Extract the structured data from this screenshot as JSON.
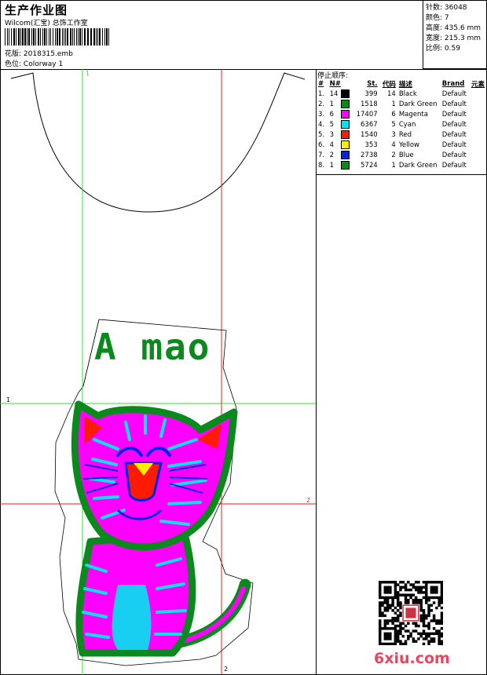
{
  "header": {
    "title": "生产作业图",
    "company": "Wilcom(汇宝) 总饰工作室",
    "design_label": "花版:",
    "design_value": "2018315.emb",
    "colorway_label": "色位:",
    "colorway_value": "Colorway 1"
  },
  "stats": [
    {
      "label": "针数:",
      "value": "36048"
    },
    {
      "label": "颜色:",
      "value": "7"
    },
    {
      "label": "高度:",
      "value": "435.6 mm"
    },
    {
      "label": "宽度:",
      "value": "215.3 mm"
    },
    {
      "label": "比例:",
      "value": "0.59"
    }
  ],
  "stop_sequence": {
    "title": "停止顺序:",
    "columns": [
      "#",
      "N#",
      "St.",
      "代码",
      "描述",
      "Brand",
      "元素"
    ],
    "rows": [
      {
        "idx": "1.",
        "n": "14",
        "color": "#000000",
        "st": "399",
        "code": "14",
        "desc": "Black",
        "brand": "Default"
      },
      {
        "idx": "2.",
        "n": "1",
        "color": "#0a8a1c",
        "st": "1518",
        "code": "1",
        "desc": "Dark Green",
        "brand": "Default"
      },
      {
        "idx": "3.",
        "n": "6",
        "color": "#ff00ff",
        "st": "17407",
        "code": "6",
        "desc": "Magenta",
        "brand": "Default"
      },
      {
        "idx": "4.",
        "n": "5",
        "color": "#00e5ef",
        "st": "6367",
        "code": "5",
        "desc": "Cyan",
        "brand": "Default"
      },
      {
        "idx": "5.",
        "n": "3",
        "color": "#ff1a00",
        "st": "1540",
        "code": "3",
        "desc": "Red",
        "brand": "Default"
      },
      {
        "idx": "6.",
        "n": "4",
        "color": "#ffee00",
        "st": "353",
        "code": "4",
        "desc": "Yellow",
        "brand": "Default"
      },
      {
        "idx": "7.",
        "n": "2",
        "color": "#0022ee",
        "st": "2738",
        "code": "2",
        "desc": "Blue",
        "brand": "Default"
      },
      {
        "idx": "8.",
        "n": "1",
        "color": "#0a8a1c",
        "st": "5724",
        "code": "1",
        "desc": "Dark Green",
        "brand": "Default"
      }
    ]
  },
  "design_text": "A mao",
  "guides": {
    "v1": "1",
    "h1": "1",
    "v2": "2",
    "h2": "2"
  },
  "watermark": "6xiu.com",
  "colors": {
    "green": "#0a8a1c",
    "magenta": "#ff00ff",
    "cyan": "#00e5ef",
    "red": "#ff1a00",
    "yellow": "#ffee00",
    "blue": "#0022ee",
    "guide_green": "#33dd33",
    "guide_red": "#dd2222"
  }
}
